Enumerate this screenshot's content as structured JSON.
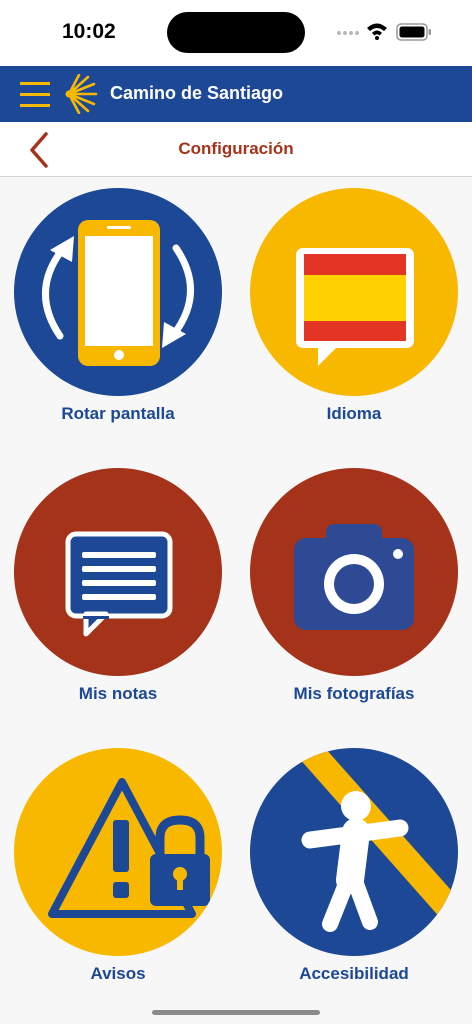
{
  "status": {
    "time": "10:02"
  },
  "app_bar": {
    "title": "Camino de Santiago"
  },
  "header": {
    "title": "Configuración"
  },
  "items": [
    {
      "label": "Rotar pantalla",
      "icon": "rotate-phone-icon"
    },
    {
      "label": "Idioma",
      "icon": "spain-flag-icon"
    },
    {
      "label": "Mis notas",
      "icon": "notes-icon"
    },
    {
      "label": "Mis fotografías",
      "icon": "camera-icon"
    },
    {
      "label": "Avisos",
      "icon": "warning-lock-icon"
    },
    {
      "label": "Accesibilidad",
      "icon": "accessibility-icon"
    }
  ],
  "colors": {
    "blue": "#1c4896",
    "yellow": "#f8b800",
    "rust": "#a5331a",
    "title_red": "#a5331a"
  }
}
